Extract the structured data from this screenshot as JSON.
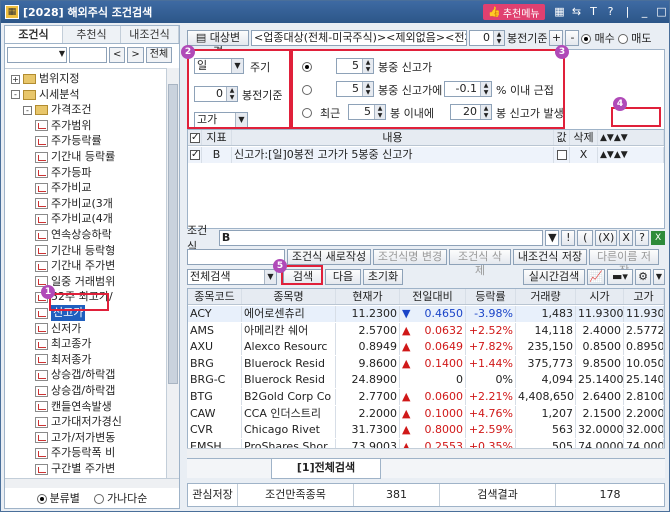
{
  "window": {
    "title": "[2028] 해외주식 조건검색",
    "recommend": "추천메뉴"
  },
  "left": {
    "tabs": [
      "조건식",
      "추천식",
      "내조건식"
    ],
    "search_button": "전체",
    "tree": [
      {
        "label": "범위지정",
        "kind": "folder",
        "level": 0,
        "expander": "+"
      },
      {
        "label": "시세분석",
        "kind": "folder",
        "level": 0,
        "expander": "-"
      },
      {
        "label": "가격조건",
        "kind": "folder",
        "level": 1,
        "expander": "-"
      },
      {
        "label": "주가범위",
        "kind": "leaf",
        "level": 2
      },
      {
        "label": "주가등락률",
        "kind": "leaf",
        "level": 2
      },
      {
        "label": "기간내 등락률",
        "kind": "leaf",
        "level": 2
      },
      {
        "label": "주가등파",
        "kind": "leaf",
        "level": 2
      },
      {
        "label": "주가비교",
        "kind": "leaf",
        "level": 2
      },
      {
        "label": "주가비교(3개",
        "kind": "leaf",
        "level": 2
      },
      {
        "label": "주가비교(4개",
        "kind": "leaf",
        "level": 2
      },
      {
        "label": "연속상승하락",
        "kind": "leaf",
        "level": 2
      },
      {
        "label": "기간내 등락형",
        "kind": "leaf",
        "level": 2
      },
      {
        "label": "기간내 주가변",
        "kind": "leaf",
        "level": 2
      },
      {
        "label": "일중 거래범위",
        "kind": "leaf",
        "level": 2
      },
      {
        "label": "52주 최고가/",
        "kind": "leaf",
        "level": 2
      },
      {
        "label": "신고가",
        "kind": "leaf",
        "level": 2,
        "selected": true
      },
      {
        "label": "신저가",
        "kind": "leaf",
        "level": 2
      },
      {
        "label": "최고종가",
        "kind": "leaf",
        "level": 2
      },
      {
        "label": "최저종가",
        "kind": "leaf",
        "level": 2
      },
      {
        "label": "상승갭/하락갭",
        "kind": "leaf",
        "level": 2
      },
      {
        "label": "상승갭/하락갭",
        "kind": "leaf",
        "level": 2
      },
      {
        "label": "캔들연속발생",
        "kind": "leaf",
        "level": 2
      },
      {
        "label": "고가대저가경신",
        "kind": "leaf",
        "level": 2
      },
      {
        "label": "고가/저가변동",
        "kind": "leaf",
        "level": 2
      },
      {
        "label": "주가등락폭 비",
        "kind": "leaf",
        "level": 2
      },
      {
        "label": "구간별 주가변",
        "kind": "leaf",
        "level": 2
      },
      {
        "label": "구간별 주가등",
        "kind": "leaf",
        "level": 2
      }
    ],
    "radio_by_category": "분류별",
    "radio_alphabet": "가나다순"
  },
  "top": {
    "target_change": "대상변경",
    "target_desc": "<업종대상(전체-미국주식)><제외없음><전체월",
    "bar_value": "0",
    "bar_label": "봉전기준",
    "buy": "매수",
    "sell": "매도"
  },
  "cond": {
    "period": "일",
    "period_label": "주기",
    "bars": "0",
    "bars_label": "봉전기준",
    "price_type": "고가",
    "opt1_bars": "5",
    "opt1_text": "봉중 신고가",
    "opt2_bars": "5",
    "opt2_text": "봉중 신고가에",
    "opt2_pct": "-0.1",
    "opt2_suffix": "% 이내 근접",
    "opt3_prefix": "최근",
    "opt3_bars": "5",
    "opt3_mid": "봉 이내에",
    "opt3_bars2": "20",
    "opt3_suffix": "봉 신고가 발생",
    "modify": "수정",
    "add": "추가"
  },
  "cond_grid": {
    "headers": [
      "지표",
      "내용",
      "값",
      "삭제"
    ],
    "rows": [
      {
        "index": "B",
        "content": "신고가:[일]0봉전 고가가 5봉중 신고가",
        "delete": "X"
      }
    ]
  },
  "formula": {
    "label": "조건식",
    "value": "B",
    "buttons": [
      "!",
      "(",
      "(X)",
      "X",
      "?"
    ]
  },
  "actions": {
    "new": "조건식 새로작성",
    "rename": "조건식명 변경",
    "delete": "조건식 삭제",
    "save": "내조건식 저장",
    "save_as": "다른이름 저장"
  },
  "results_bar": {
    "scope": "전체검색",
    "search": "검색",
    "next": "다음",
    "reset": "초기화",
    "realtime": "실시간검색"
  },
  "result_grid": {
    "headers": [
      "종목코드",
      "종목명",
      "현재가",
      "전일대비",
      "등락률",
      "거래량",
      "시가",
      "고가"
    ],
    "rows": [
      {
        "code": "ACY",
        "name": "에어로센츄리",
        "price": "11.2300",
        "dir": "down",
        "chg": "0.4650",
        "pct": "-3.98%",
        "vol": "1,483",
        "open": "11.9300",
        "high": "11.9300"
      },
      {
        "code": "AMS",
        "name": "아메리칸 쉐어",
        "price": "2.5700",
        "dir": "up",
        "chg": "0.0632",
        "pct": "+2.52%",
        "vol": "14,118",
        "open": "2.4000",
        "high": "2.5772"
      },
      {
        "code": "AXU",
        "name": "Alexco Resourc",
        "price": "0.8949",
        "dir": "up",
        "chg": "0.0649",
        "pct": "+7.82%",
        "vol": "235,150",
        "open": "0.8500",
        "high": "0.8950"
      },
      {
        "code": "BRG",
        "name": "Bluerock Resid",
        "price": "9.8600",
        "dir": "up",
        "chg": "0.1400",
        "pct": "+1.44%",
        "vol": "375,773",
        "open": "9.8500",
        "high": "10.0500"
      },
      {
        "code": "BRG-C",
        "name": "Bluerock Resid",
        "price": "24.8900",
        "dir": "flat",
        "chg": "0",
        "pct": "0%",
        "vol": "4,094",
        "open": "25.1400",
        "high": "25.1400"
      },
      {
        "code": "BTG",
        "name": "B2Gold Corp Co",
        "price": "2.7700",
        "dir": "up",
        "chg": "0.0600",
        "pct": "+2.21%",
        "vol": "4,408,650",
        "open": "2.6400",
        "high": "2.8100"
      },
      {
        "code": "CAW",
        "name": "CCA 인더스트리",
        "price": "2.2000",
        "dir": "up",
        "chg": "0.1000",
        "pct": "+4.76%",
        "vol": "1,207",
        "open": "2.1500",
        "high": "2.2000"
      },
      {
        "code": "CVR",
        "name": "Chicago Rivet",
        "price": "31.7300",
        "dir": "up",
        "chg": "0.8000",
        "pct": "+2.59%",
        "vol": "563",
        "open": "32.0000",
        "high": "32.0000"
      },
      {
        "code": "EMSH",
        "name": "ProShares Shor",
        "price": "73.9003",
        "dir": "up",
        "chg": "0.2553",
        "pct": "+0.35%",
        "vol": "505",
        "open": "74.0000",
        "high": "74.0000"
      }
    ]
  },
  "bottom_tab": "[1]전체검색",
  "status": {
    "save": "관심저장",
    "count_label": "조건만족종목",
    "count": "381",
    "result_label": "검색결과",
    "result": "178"
  },
  "badges": [
    "1",
    "2",
    "3",
    "4",
    "5"
  ],
  "colors": {
    "title": "#2c5688",
    "accent_red": "#e0203a",
    "badge": "#b04ab8",
    "up": "#d01818",
    "down": "#1a44c8"
  }
}
